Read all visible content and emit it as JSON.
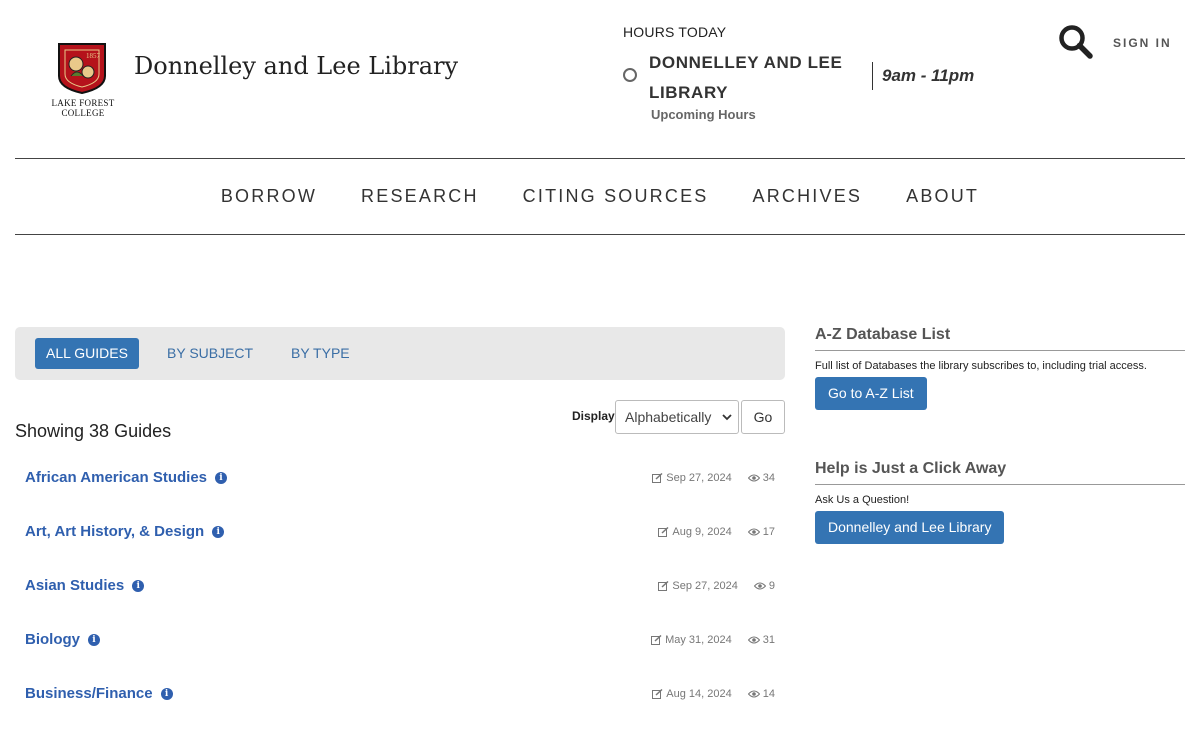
{
  "header": {
    "logo": {
      "year": "1857",
      "college_line1": "LAKE FOREST",
      "college_line2": "COLLEGE",
      "brand_color": "#b5121b"
    },
    "site_title": "Donnelley and Lee Library",
    "hours": {
      "label": "HOURS TODAY",
      "location": "DONNELLEY AND LEE LIBRARY",
      "time": "9am - 11pm",
      "upcoming": "Upcoming Hours"
    },
    "search_icon": "search-icon",
    "sign_in": "SIGN IN"
  },
  "nav": {
    "items": [
      {
        "label": "BORROW"
      },
      {
        "label": "RESEARCH"
      },
      {
        "label": "CITING SOURCES"
      },
      {
        "label": "ARCHIVES"
      },
      {
        "label": "ABOUT"
      }
    ]
  },
  "tabs": {
    "items": [
      {
        "label": "ALL GUIDES",
        "active": true
      },
      {
        "label": "BY SUBJECT",
        "active": false
      },
      {
        "label": "BY TYPE",
        "active": false
      }
    ]
  },
  "listing": {
    "showing": "Showing 38 Guides",
    "display_label": "Display",
    "display_value": "Alphabetically",
    "go_label": "Go",
    "guides": [
      {
        "title": "African American Studies",
        "updated": "Sep 27, 2024",
        "views": "34"
      },
      {
        "title": "Art, Art History, & Design",
        "updated": "Aug 9, 2024",
        "views": "17"
      },
      {
        "title": "Asian Studies",
        "updated": "Sep 27, 2024",
        "views": "9"
      },
      {
        "title": "Biology",
        "updated": "May 31, 2024",
        "views": "31"
      },
      {
        "title": "Business/Finance",
        "updated": "Aug 14, 2024",
        "views": "14"
      }
    ]
  },
  "sidebar": {
    "az": {
      "title": "A-Z Database List",
      "text": "Full list of Databases the library subscribes to, including trial access.",
      "button": "Go to A-Z List"
    },
    "help": {
      "title": "Help is Just a Click Away",
      "text": "Ask Us a Question!",
      "button": "Donnelley and Lee Library"
    }
  },
  "colors": {
    "accent": "#3474b3",
    "link": "#2f5fae"
  }
}
